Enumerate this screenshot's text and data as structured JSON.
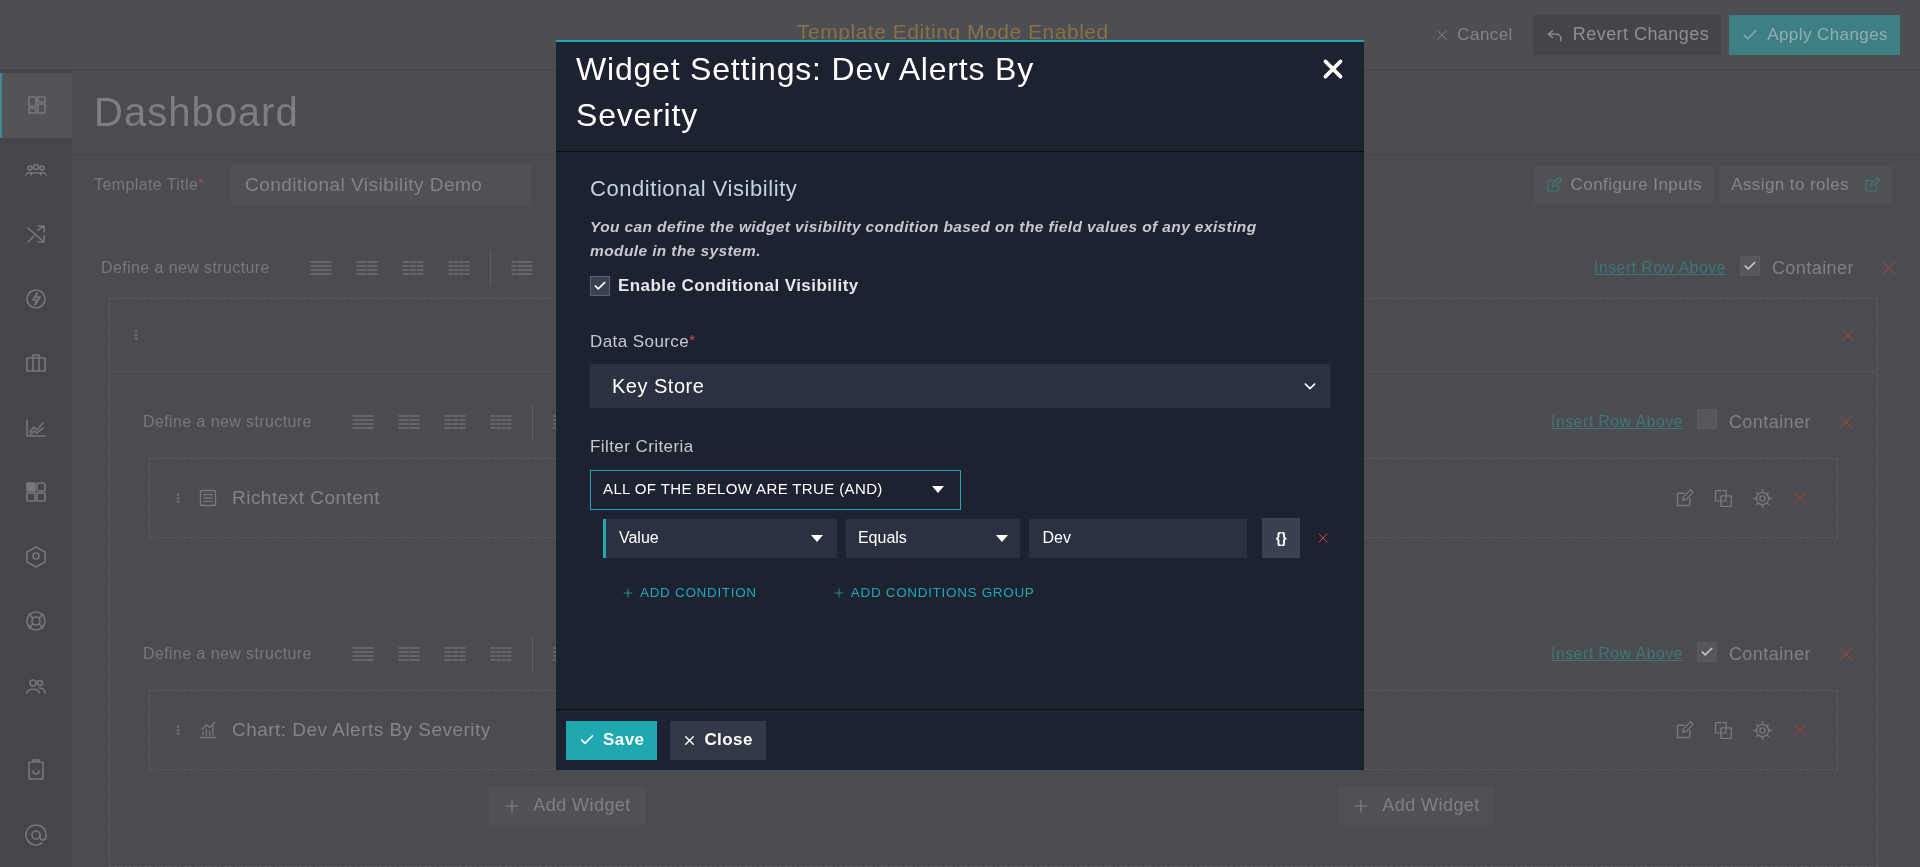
{
  "top_bar": {
    "mode_banner": "Template Editing Mode Enabled",
    "buttons": [
      {
        "label": "Cancel",
        "kind": "plain"
      },
      {
        "label": "Revert Changes",
        "kind": "revert"
      },
      {
        "label": "Apply Changes",
        "kind": "apply"
      }
    ]
  },
  "sidebar": {
    "items": [
      {
        "selected": true
      },
      {
        "selected": false
      },
      {
        "selected": false
      },
      {
        "selected": false
      },
      {
        "selected": false
      },
      {
        "selected": false
      },
      {
        "selected": false
      },
      {
        "selected": false
      },
      {
        "selected": false
      },
      {
        "selected": false
      },
      {
        "selected": false
      },
      {
        "selected": false
      }
    ]
  },
  "page": {
    "title": "Dashboard",
    "template_title": {
      "label": "Template Title",
      "required_mark": "*",
      "value": "Conditional Visibility Demo"
    },
    "buttons": [
      "Configure Inputs",
      "Assign to roles"
    ]
  },
  "structure": {
    "label": "Define a new structure",
    "insert_link": "Insert Row Above",
    "container": {
      "label": "Container",
      "checked": true
    },
    "rows": [
      {
        "label": "Define a new structure",
        "insert_link": "Insert Row Above",
        "container": {
          "label": "Container",
          "checked": false
        },
        "widget": {
          "title": "Richtext Content",
          "kind": "text"
        },
        "add_widget": []
      },
      {
        "label": "Define a new structure",
        "insert_link": "Insert Row Above",
        "container": {
          "label": "Container",
          "checked": true
        },
        "widget": {
          "title": "Chart: Dev Alerts By Severity",
          "kind": "chart"
        },
        "add_widget": [
          "Add Widget",
          "Add Widget"
        ]
      }
    ]
  },
  "modal": {
    "title": "Widget Settings: Dev Alerts By Severity",
    "section_title": "Conditional Visibility",
    "description": "You can define the widget visibility condition based on the field values of any existing module in the system.",
    "enable": {
      "label": "Enable Conditional Visibility",
      "checked": true
    },
    "data_source": {
      "label": "Data Source",
      "required_mark": "*",
      "value": "Key Store"
    },
    "filter": {
      "label": "Filter Criteria",
      "logic": "ALL OF THE BELOW ARE TRUE (AND)",
      "conditions": [
        {
          "field": "Value",
          "operator": "Equals",
          "value": "Dev",
          "expression_button": "{}"
        }
      ],
      "links": [
        "ADD CONDITION",
        "ADD CONDITIONS GROUP"
      ]
    },
    "footer_buttons": [
      {
        "label": "Save",
        "kind": "primary"
      },
      {
        "label": "Close",
        "kind": "secondary"
      }
    ]
  }
}
